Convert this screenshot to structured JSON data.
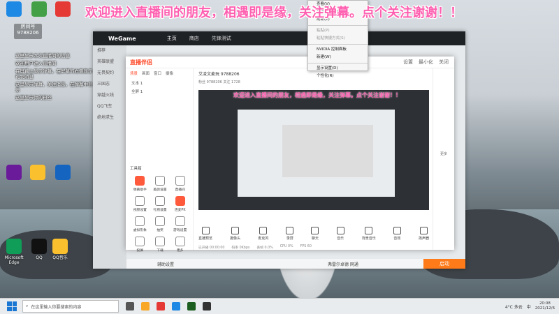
{
  "overlay": {
    "banner": "欢迎进入直播间的朋友，相遇即是缘，关注弹幕。点个关注谢谢！！",
    "host_label": "房间号",
    "room_id": "9788206",
    "chat": [
      "这里显示本次直播间的信息",
      "欢迎用户进入直播间",
      "在屏幕上显示弹幕，在屏幕的右侧显示礼物消息",
      "这里显示弹幕，关注消息，在弹幕中显示",
      "这里显示你的粉丝"
    ]
  },
  "desktop_icons": [
    {
      "label": "",
      "color": "#1e88e5"
    },
    {
      "label": "",
      "color": "#43a047"
    },
    {
      "label": "",
      "color": "#e53935"
    },
    {
      "label": "",
      "color": "#6a1b9a"
    },
    {
      "label": "",
      "color": "#fbc02d"
    },
    {
      "label": "",
      "color": "#1565c0"
    },
    {
      "label": "Microsoft Edge",
      "color": "#0f9d58"
    },
    {
      "label": "QQ",
      "color": "#111111"
    },
    {
      "label": "QQ音乐",
      "color": "#fbc02d"
    }
  ],
  "wegame": {
    "logo": "WeGame",
    "nav": [
      "主页",
      "商店",
      "先锋测试"
    ],
    "side": [
      "推荐",
      "英雄联盟",
      "无畏契约",
      "三国志",
      "穿越火线",
      "QQ飞车",
      "绝地求生"
    ],
    "bottom": "辅助设置",
    "game": "弗雷尔卓德 网通",
    "launch": "启动"
  },
  "studio": {
    "brand": "直播伴侣",
    "header_tools": [
      "设置",
      "最小化",
      "关闭"
    ],
    "tabs": [
      "场景",
      "画面",
      "窗口",
      "摄像"
    ],
    "sources": [
      "文本 1",
      "全屏 1"
    ],
    "tools_title": "工具箱",
    "tools": [
      "弹幕助手",
      "美颜设置",
      "直播间",
      "视频设置",
      "礼物设置",
      "连麦PK",
      "虚拟形象",
      "抽奖",
      "游戏设置",
      "投屏",
      "下载",
      "更多"
    ],
    "info": "艾凌文麦玩 9788206",
    "info2": "粉丝 9788206  关注 1728",
    "bottom": [
      "直播预览",
      "摄像头",
      "麦克风",
      "录屏",
      "聊天",
      "音乐",
      "背景音乐",
      "音效",
      "扬声器"
    ],
    "status": [
      "已开播 00:00:00",
      "码率 0Kbps",
      "丢帧 0.0%",
      "CPU 0%",
      "FPS 60"
    ],
    "right": [
      "更多"
    ],
    "preview_banner": "欢迎进入直播间的朋友，相遇即是缘，关注弹幕。点个关注谢谢！！"
  },
  "context_menu": [
    {
      "label": "查看(V)",
      "dim": false
    },
    {
      "label": "排序方式(O)",
      "dim": false
    },
    {
      "label": "刷新(E)",
      "dim": false
    },
    {
      "label": "粘贴(P)",
      "dim": true
    },
    {
      "label": "粘贴快捷方式(S)",
      "dim": true
    },
    {
      "label": "NVIDIA 控制面板",
      "dim": false
    },
    {
      "label": "新建(W)",
      "dim": false
    },
    {
      "label": "显示设置(D)",
      "dim": false
    },
    {
      "label": "个性化(R)",
      "dim": false
    }
  ],
  "taskbar": {
    "search_placeholder": "在这里输入你要搜索的内容",
    "app_colors": [
      "#555555",
      "#f9a825",
      "#e53935",
      "#1e88e5",
      "#1b5e20",
      "#333333"
    ],
    "temp": "4°C 多云",
    "ime": "中",
    "time": "20:08",
    "date": "2021/12/6"
  }
}
